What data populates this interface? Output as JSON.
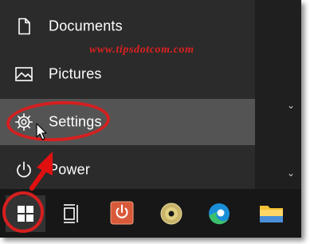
{
  "watermark": "www.tipsdotcom.com",
  "menu": {
    "items": [
      {
        "label": "Documents",
        "icon": "document-icon"
      },
      {
        "label": "Pictures",
        "icon": "pictures-icon"
      },
      {
        "label": "Settings",
        "icon": "gear-icon",
        "highlighted": true
      },
      {
        "label": "Power",
        "icon": "power-icon"
      }
    ]
  },
  "taskbar": {
    "buttons": [
      {
        "name": "start-button",
        "icon": "windows-logo-icon"
      },
      {
        "name": "task-view-button",
        "icon": "task-view-icon"
      },
      {
        "name": "app-button",
        "icon": "power-app-icon"
      },
      {
        "name": "media-button",
        "icon": "disc-icon"
      },
      {
        "name": "edge-button",
        "icon": "edge-icon"
      },
      {
        "name": "file-explorer-button",
        "icon": "folder-icon"
      }
    ]
  },
  "colors": {
    "annotation_red": "#d61f1f",
    "menu_bg": "#2b2b2b",
    "highlight_bg": "#545454",
    "taskbar_bg": "#171717"
  }
}
